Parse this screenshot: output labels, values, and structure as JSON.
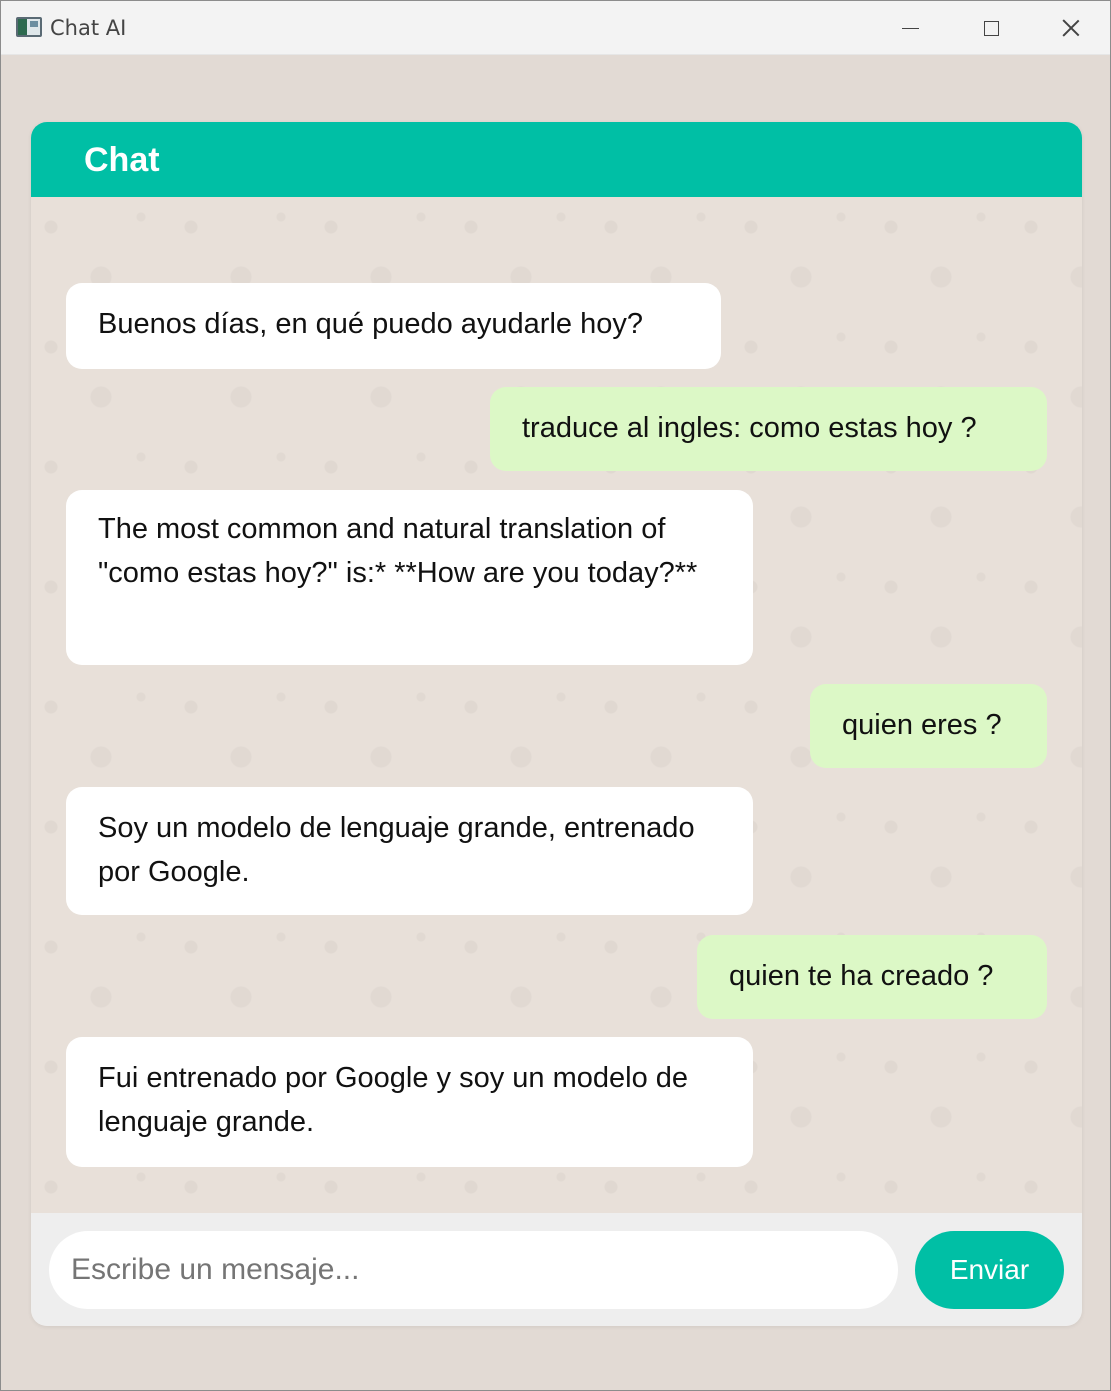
{
  "window": {
    "title": "Chat AI"
  },
  "chat": {
    "title": "Chat",
    "messages": [
      {
        "sender": "bot",
        "text": "Buenos días, en qué puedo ayudarle hoy?"
      },
      {
        "sender": "user",
        "text": "traduce al ingles: como estas hoy ?"
      },
      {
        "sender": "bot",
        "text": "The most common and natural translation of \"como estas hoy?\" is:* **How are you today?**"
      },
      {
        "sender": "user",
        "text": "quien eres ?"
      },
      {
        "sender": "bot",
        "text": "Soy un modelo de lenguaje grande, entrenado por Google."
      },
      {
        "sender": "user",
        "text": "quien te ha creado ?"
      },
      {
        "sender": "bot",
        "text": "Fui entrenado por Google y soy un modelo de lenguaje grande."
      }
    ]
  },
  "composer": {
    "placeholder": "Escribe un mensaje...",
    "value": "",
    "send_label": "Enviar"
  },
  "colors": {
    "accent": "#00bfa5",
    "user_bubble": "#dcf8c6",
    "bot_bubble": "#ffffff",
    "background": "#e5ddd5"
  }
}
